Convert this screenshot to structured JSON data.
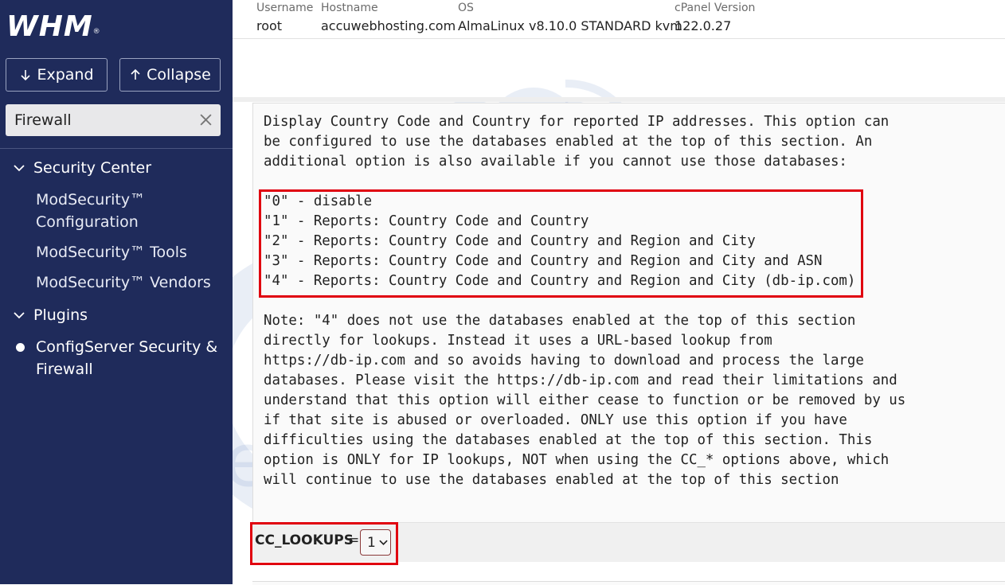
{
  "sidebar": {
    "logo": "WHM",
    "logo_mark": "®",
    "expand_label": "Expand",
    "collapse_label": "Collapse",
    "search": {
      "value": "Firewall"
    },
    "groups": [
      {
        "label": "Security Center",
        "items": [
          "ModSecurity™ Configuration",
          "ModSecurity™ Tools",
          "ModSecurity™ Vendors"
        ]
      },
      {
        "label": "Plugins",
        "items": [
          "ConfigServer Security & Firewall"
        ]
      }
    ]
  },
  "header": {
    "username_label": "Username",
    "username": "root",
    "hostname_label": "Hostname",
    "hostname": "accuwebhosting.com",
    "os_label": "OS",
    "os": "AlmaLinux v8.10.0 STANDARD kvm",
    "cpanel_label": "cPanel Version",
    "cpanel": "122.0.27"
  },
  "description": {
    "intro": [
      "Display Country Code and Country for reported IP addresses. This option can",
      "be configured to use the databases enabled at the top of this section. An",
      "additional option is also available if you cannot use those databases:"
    ],
    "options": [
      "\"0\" - disable",
      "\"1\" - Reports: Country Code and Country",
      "\"2\" - Reports: Country Code and Country and Region and City",
      "\"3\" - Reports: Country Code and Country and Region and City and ASN",
      "\"4\" - Reports: Country Code and Country and Region and City (db-ip.com)"
    ],
    "note": [
      "Note: \"4\" does not use the databases enabled at the top of this section",
      "directly for lookups. Instead it uses a URL-based lookup from",
      "https://db-ip.com and so avoids having to download and process the large",
      "databases. Please visit the https://db-ip.com and read their limitations and",
      "understand that this option will either cease to function or be removed by us",
      "if that site is abused or overloaded. ONLY use this option if you have",
      "difficulties using the databases enabled at the top of this section. This",
      "option is ONLY for IP lookups, NOT when using the CC_* options above, which",
      "will continue to use the databases enabled at the top of this section"
    ]
  },
  "setting": {
    "name": "CC_LOOKUPS",
    "equals": "=",
    "selected": "1"
  },
  "colors": {
    "sidebar_bg": "#1f2b5b",
    "highlight": "#e0000f",
    "watermark": "#2a5aa8"
  }
}
